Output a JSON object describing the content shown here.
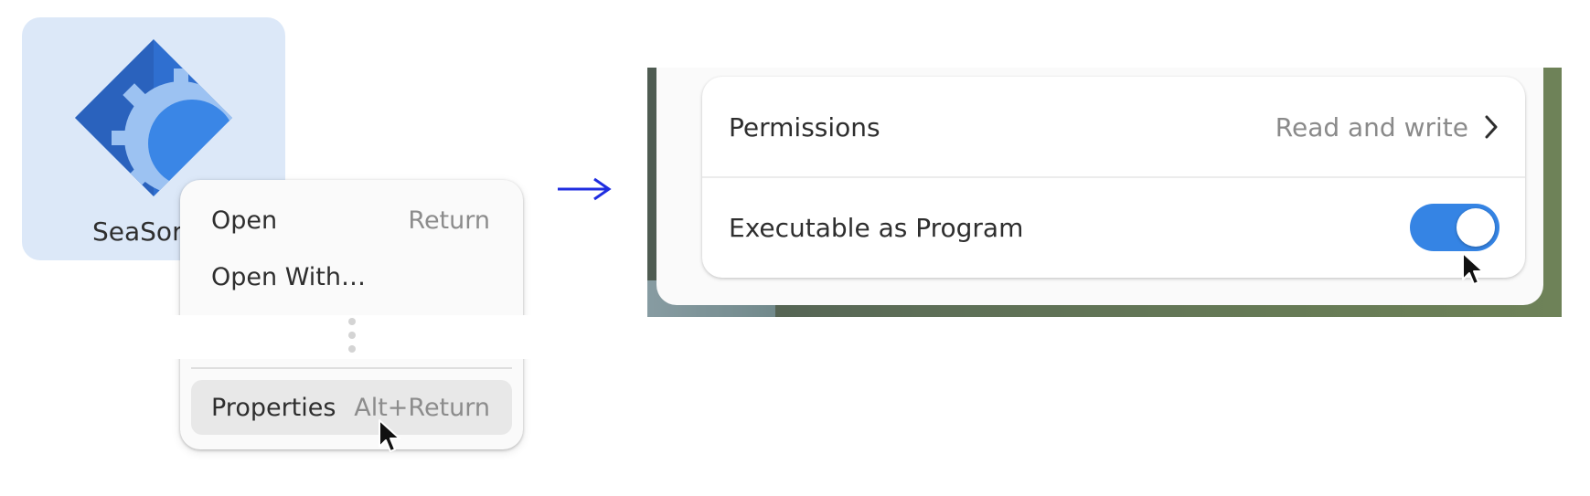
{
  "file": {
    "name": "SeaSort",
    "icon": "seasort-gear-diamond-icon"
  },
  "context_menu": {
    "items": [
      {
        "label": "Open",
        "shortcut": "Return"
      },
      {
        "label": "Open With…",
        "shortcut": ""
      },
      {
        "label": "Properties",
        "shortcut": "Alt+Return",
        "hovered": true
      }
    ]
  },
  "transition_arrow": "right-arrow-icon",
  "properties": {
    "permissions": {
      "label": "Permissions",
      "value": "Read and write"
    },
    "executable": {
      "label": "Executable as Program",
      "enabled": true
    }
  },
  "colors": {
    "accent": "#3584e4",
    "tile_selected": "#dce8f8",
    "arrow": "#1f2de0",
    "dim_text": "#8c8c8c"
  }
}
